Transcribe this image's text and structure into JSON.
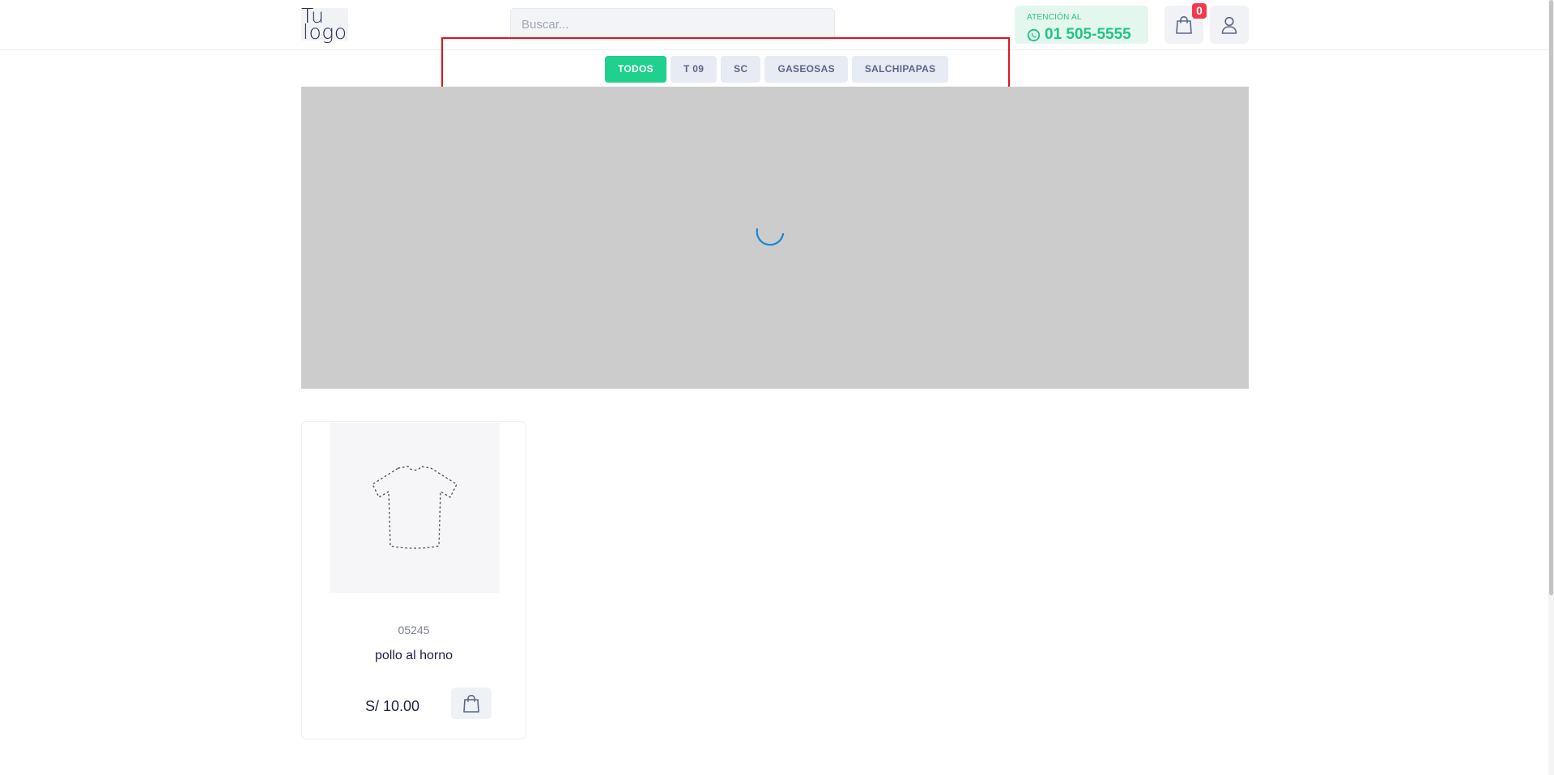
{
  "header": {
    "logo": {
      "line1": "Tu",
      "line2": "logo"
    },
    "search": {
      "placeholder": "Buscar..."
    },
    "attention": {
      "label": "ATENCIÓN AL",
      "phone": "01 505-5555",
      "icon": "whatsapp-icon"
    },
    "cart": {
      "icon": "shopping-bag-icon",
      "count": "0"
    },
    "user": {
      "icon": "user-icon"
    }
  },
  "categories": {
    "tabs": [
      {
        "label": "TODOS",
        "active": true
      },
      {
        "label": "T 09",
        "active": false
      },
      {
        "label": "SC",
        "active": false
      },
      {
        "label": "GASEOSAS",
        "active": false
      },
      {
        "label": "SALCHIPAPAS",
        "active": false
      }
    ]
  },
  "banner": {
    "state": "loading"
  },
  "products": [
    {
      "sku": "05245",
      "name": "pollo al horno",
      "price": "S/ 10.00",
      "image": "tshirt-placeholder-icon",
      "action_icon": "shopping-bag-icon"
    }
  ],
  "colors": {
    "accent": "#20d08d",
    "badge": "#f3394d",
    "highlight": "#e0141e",
    "banner": "#cccccc"
  }
}
